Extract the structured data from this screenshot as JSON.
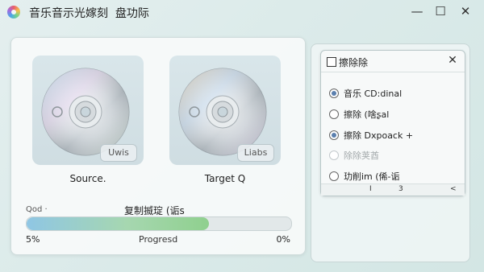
{
  "window": {
    "title": "音乐音示光嫁刻  盘功际",
    "minimize": "—",
    "maximize": "☐",
    "close": "✕"
  },
  "discs": {
    "source": {
      "label": "Source.",
      "badge": "Uwis"
    },
    "target": {
      "label": "Target Q",
      "badge": "Liabs"
    }
  },
  "progress": {
    "left_caption": "Qod ·",
    "center_caption": "复制揻琔 (诟s",
    "value_pct": 69,
    "left_value": "5%",
    "label": "Progresd",
    "right_value": "0%"
  },
  "dialog": {
    "title": "擦除除",
    "close": "✕",
    "options": [
      {
        "label": "音乐 CD:dinal",
        "selected": true,
        "disabled": false
      },
      {
        "label": "擦除 (啥ʂal",
        "selected": false,
        "disabled": false
      },
      {
        "label": "擦除 Dxpoack +",
        "selected": true,
        "disabled": false
      },
      {
        "label": "除除荚酋",
        "selected": false,
        "disabled": true
      },
      {
        "label": "玏削im (俙-诟",
        "selected": false,
        "disabled": false
      }
    ],
    "pager": {
      "page": "I",
      "count": "3",
      "prev": "<"
    }
  },
  "colors": {
    "accent": "#5a7fae",
    "progress_start": "#8fc6e4",
    "progress_end": "#8fd08e"
  }
}
